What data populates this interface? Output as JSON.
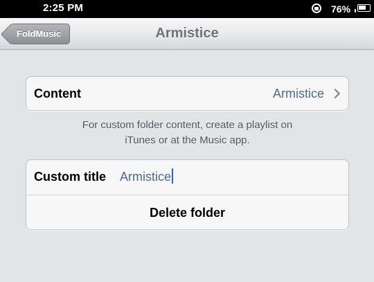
{
  "status_bar": {
    "time": "2:25 PM",
    "battery": "76%",
    "battery_level": 0.76
  },
  "nav": {
    "back_label": "FoldMusic",
    "title": "Armistice"
  },
  "content_cell": {
    "label": "Content",
    "value": "Armistice"
  },
  "footer_note": {
    "line1": "For custom folder content, create a playlist on",
    "line2": "iTunes or at the Music app."
  },
  "title_cell": {
    "label": "Custom title",
    "value": "Armistice"
  },
  "delete_cell": {
    "label": "Delete folder"
  },
  "colors": {
    "accent": "#4b6a92",
    "background": "#e3e4e6"
  },
  "icons": {
    "rotation_lock": "rotation-lock-icon",
    "battery": "battery-icon",
    "chevron": "chevron-right-icon"
  }
}
